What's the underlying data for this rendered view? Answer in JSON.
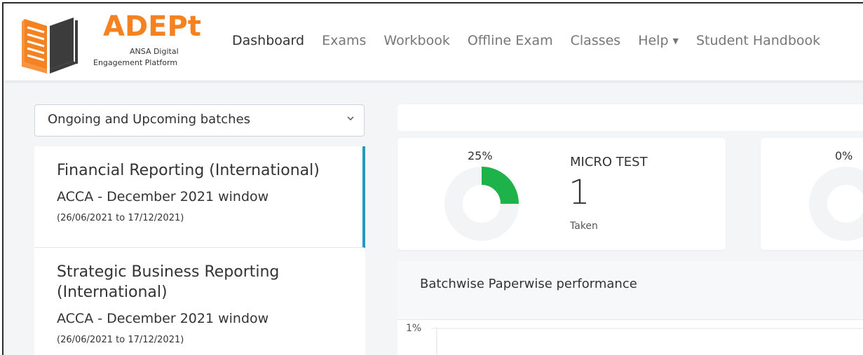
{
  "brand": {
    "title": "ADEPt",
    "subtitle_line1": "ANSA Digital",
    "subtitle_line2": "Engagement Platform",
    "colors": {
      "orange": "#f58220",
      "dark": "#3c3c3c"
    }
  },
  "nav": {
    "items": [
      {
        "label": "Dashboard",
        "active": true
      },
      {
        "label": "Exams"
      },
      {
        "label": "Workbook"
      },
      {
        "label": "Offline Exam"
      },
      {
        "label": "Classes"
      },
      {
        "label": "Help",
        "dropdown": true
      },
      {
        "label": "Student Handbook"
      }
    ]
  },
  "sidebar": {
    "filter": {
      "selected": "Ongoing and Upcoming batches",
      "icon": "chevron-down-icon"
    },
    "batches": [
      {
        "name": "Financial Reporting (International)",
        "window": "ACCA - December 2021 window",
        "dates": "(26/06/2021 to 17/12/2021)",
        "selected": true
      },
      {
        "name": "Strategic Business Reporting (International)",
        "window": "ACCA - December 2021 window",
        "dates": "(26/06/2021 to 17/12/2021)"
      }
    ]
  },
  "stats": [
    {
      "percent_label": "25%",
      "percent": 25,
      "title": "MICRO TEST",
      "count": "1",
      "sub": "Taken",
      "color": "#1db34a"
    },
    {
      "percent_label": "0%",
      "percent": 0
    }
  ],
  "performance": {
    "title": "Batchwise Paperwise performance",
    "y_tick": "1%"
  }
}
